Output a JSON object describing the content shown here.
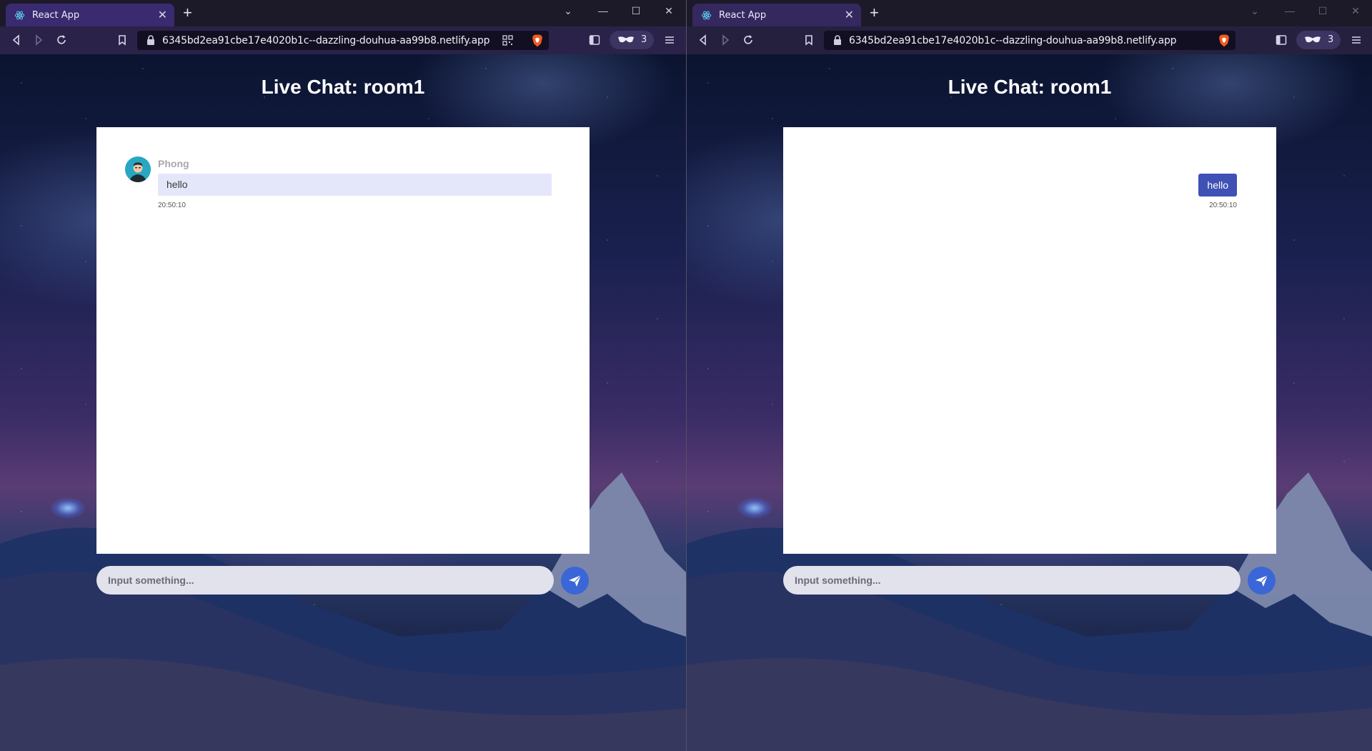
{
  "windows": [
    {
      "tab": {
        "title": "React App"
      },
      "url": "6345bd2ea91cbe17e4020b1c--dazzling-douhua-aa99b8.netlify.app",
      "rewards_count": "3",
      "chat": {
        "title": "Live Chat: room1",
        "messages": [
          {
            "side": "left",
            "sender": "Phong",
            "text": "hello",
            "time": "20:50:10"
          }
        ],
        "input_placeholder": "Input something..."
      }
    },
    {
      "tab": {
        "title": "React App"
      },
      "url": "6345bd2ea91cbe17e4020b1c--dazzling-douhua-aa99b8.netlify.app",
      "rewards_count": "3",
      "chat": {
        "title": "Live Chat: room1",
        "messages": [
          {
            "side": "right",
            "text": "hello",
            "time": "20:50:10"
          }
        ],
        "input_placeholder": "Input something..."
      }
    }
  ],
  "colors": {
    "accent": "#3f51b5",
    "send_button": "#3a66d8",
    "bubble_incoming": "#e4e7fa",
    "tab_active": "#3a2a70"
  },
  "icons": [
    "react-icon",
    "close-icon",
    "plus-icon",
    "chevron-down-icon",
    "minimize-icon",
    "maximize-icon",
    "back-icon",
    "forward-icon",
    "reload-icon",
    "bookmark-icon",
    "lock-icon",
    "qr-code-icon",
    "brave-shield-icon",
    "sidebar-icon",
    "rewards-icon",
    "menu-icon",
    "send-icon"
  ]
}
